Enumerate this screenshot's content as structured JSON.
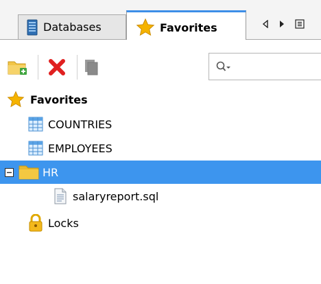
{
  "tabs": {
    "databases": {
      "label": "Databases",
      "icon": "database-icon"
    },
    "favorites": {
      "label": "Favorites",
      "icon": "star-icon",
      "active": true
    }
  },
  "tab_nav": {
    "left": "scroll-left-icon",
    "right": "scroll-right-icon",
    "list": "tab-list-icon"
  },
  "toolbar": {
    "buttons": [
      {
        "name": "new-folder-button",
        "icon": "new-folder-icon",
        "enabled": true
      },
      {
        "name": "remove-button",
        "icon": "delete-x-icon",
        "enabled": true
      },
      {
        "name": "copy-button",
        "icon": "copy-icon",
        "enabled": false
      }
    ],
    "search": {
      "placeholder": "",
      "value": "",
      "icon": "search-filter-icon"
    }
  },
  "tree": {
    "root": {
      "label": "Favorites",
      "icon": "star-icon"
    },
    "items": [
      {
        "label": "COUNTRIES",
        "icon": "table-icon"
      },
      {
        "label": "EMPLOYEES",
        "icon": "table-icon"
      },
      {
        "label": "HR",
        "icon": "folder-icon",
        "expanded": true,
        "selected": true
      },
      {
        "label": "salaryreport.sql",
        "icon": "sql-file-icon"
      },
      {
        "label": "Locks",
        "icon": "lock-icon"
      }
    ]
  },
  "colors": {
    "selection": "#3d95ee",
    "active_tab_accent": "#3d8ee8",
    "delete_red": "#e02020",
    "star_gold": "#f5b300",
    "folder_yellow": "#f4c842"
  }
}
